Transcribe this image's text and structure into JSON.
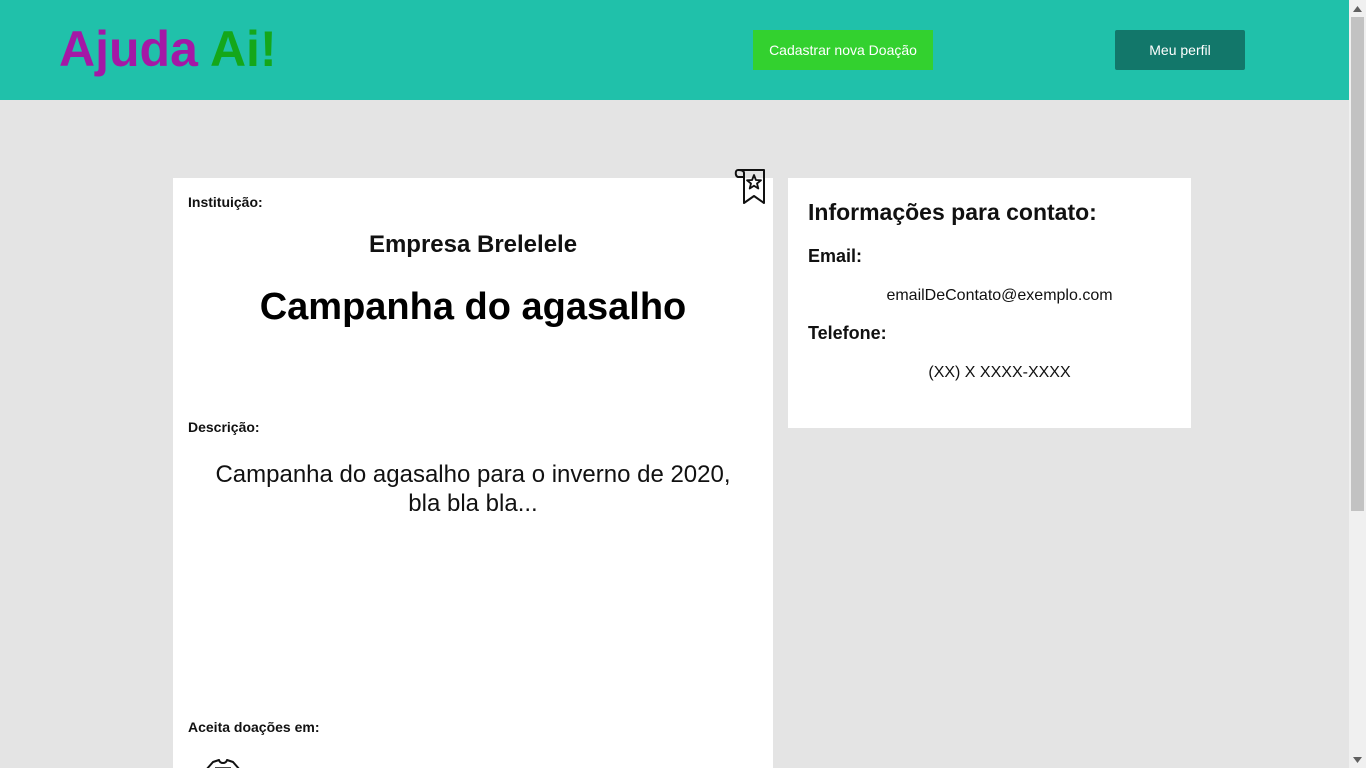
{
  "header": {
    "logo_part1": "Ajuda",
    "logo_part2": "Ai!",
    "new_donation_label": "Cadastrar nova Doação",
    "profile_label": "Meu perfil",
    "colors": {
      "bar": "#20c1aa",
      "logo_part1": "#a418a6",
      "logo_part2": "#14a71a",
      "new_donation_button": "#33d12f",
      "profile_button": "#12776a"
    }
  },
  "campaign": {
    "institution_label": "Instituição:",
    "institution_name": "Empresa Brelelele",
    "title": "Campanha do agasalho",
    "description_label": "Descrição:",
    "description": "Campanha do agasalho para o inverno de 2020, bla bla bla...",
    "accepts_label": "Aceita doações em:",
    "bookmark_icon": "bookmark-star-icon",
    "accepted_icons": [
      "clothes-icon"
    ]
  },
  "contact": {
    "title": "Informações para contato:",
    "email_label": "Email:",
    "email": "emailDeContato@exemplo.com",
    "phone_label": "Telefone:",
    "phone": "(XX) X XXXX-XXXX"
  }
}
